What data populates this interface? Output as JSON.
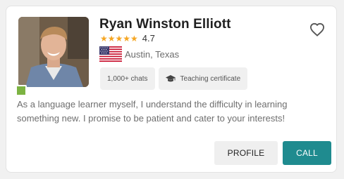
{
  "tutor": {
    "name": "Ryan Winston Elliott",
    "rating_stars": "★★★★★",
    "rating": "4.7",
    "location": "Austin, Texas",
    "country_flag": "us-flag",
    "online": true
  },
  "chips": [
    {
      "label": "1,000+ chats"
    },
    {
      "label": "Teaching certificate",
      "icon": "graduation-cap-icon"
    }
  ],
  "description": "As a language learner myself, I understand the difficulty in learning something new. I promise to be patient and cater to your interests!",
  "actions": {
    "profile_label": "PROFILE",
    "call_label": "CALL"
  },
  "colors": {
    "accent": "#1f8b8f",
    "star": "#f5a623",
    "online": "#7cb342"
  }
}
